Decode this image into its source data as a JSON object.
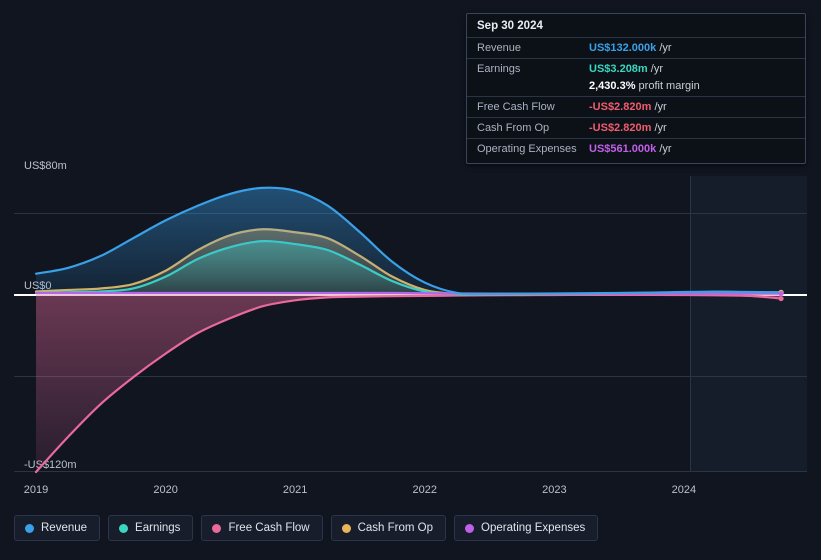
{
  "chart_data": {
    "type": "area",
    "title": "",
    "xlabel": "",
    "ylabel": "",
    "grid": true,
    "legend_position": "bottom-left",
    "ylim": [
      -120,
      80
    ],
    "y_unit": "US$ millions",
    "y_ticks": [
      {
        "value": 80,
        "label": "US$80m"
      },
      {
        "value": 0,
        "label": "US$0"
      },
      {
        "value": -120,
        "label": "-US$120m"
      }
    ],
    "x_ticks": [
      "2019",
      "2020",
      "2021",
      "2022",
      "2023",
      "2024"
    ],
    "x_range": [
      "2018-10",
      "2024-12"
    ],
    "forecast_band_start": "2024-02",
    "x": [
      "2019.0",
      "2019.25",
      "2019.5",
      "2019.75",
      "2020.0",
      "2020.25",
      "2020.5",
      "2020.75",
      "2021.0",
      "2021.25",
      "2021.5",
      "2021.75",
      "2022.0",
      "2022.25",
      "2022.5",
      "2022.75",
      "2023.0",
      "2023.25",
      "2023.5",
      "2023.75",
      "2024.0",
      "2024.25",
      "2024.5",
      "2024.75"
    ],
    "series": [
      {
        "name": "Revenue",
        "color": "#3aa0e8",
        "values": [
          14,
          18,
          26,
          38,
          50,
          60,
          68,
          72,
          70,
          60,
          42,
          22,
          8,
          1,
          0.4,
          0.5,
          0.6,
          0.8,
          1.0,
          1.2,
          1.6,
          1.8,
          1.6,
          1.4
        ]
      },
      {
        "name": "Earnings",
        "color": "#3ad6c0",
        "values": [
          1,
          1.5,
          2,
          4,
          12,
          24,
          32,
          36,
          34,
          30,
          20,
          9,
          2,
          0.2,
          0.1,
          0.2,
          0.3,
          0.4,
          0.6,
          0.8,
          1.2,
          1.6,
          1.5,
          1.3
        ]
      },
      {
        "name": "Free Cash Flow",
        "color": "#e8699a",
        "values": [
          -120,
          -96,
          -74,
          -56,
          -40,
          -26,
          -16,
          -8,
          -4,
          -2,
          -1.5,
          -1.2,
          -1.0,
          -0.8,
          -0.6,
          -0.5,
          -0.4,
          -0.3,
          -0.3,
          -0.3,
          -0.4,
          -0.6,
          -1.0,
          -2.8
        ]
      },
      {
        "name": "Cash From Op",
        "color": "#e8b35a",
        "values": [
          2,
          3,
          4,
          7,
          16,
          30,
          40,
          44,
          42,
          38,
          26,
          12,
          3,
          0.3,
          0.2,
          0.2,
          0.3,
          0.5,
          0.7,
          0.9,
          1.3,
          1.7,
          1.5,
          1.3
        ]
      },
      {
        "name": "Operating Expenses",
        "color": "#c060e8",
        "values": [
          1,
          1,
          1,
          1,
          1,
          1,
          1,
          1,
          1,
          1,
          1,
          1,
          0.8,
          0.6,
          0.5,
          0.5,
          0.5,
          0.5,
          0.5,
          0.5,
          0.5,
          0.56,
          0.56,
          0.56
        ]
      }
    ]
  },
  "tooltip": {
    "date": "Sep 30 2024",
    "rows": [
      {
        "label": "Revenue",
        "value": "US$132.000k",
        "unit": "/yr",
        "color": "#3aa0e8"
      },
      {
        "label": "Earnings",
        "value": "US$3.208m",
        "unit": "/yr",
        "color": "#3ad6c0"
      },
      {
        "label": "Free Cash Flow",
        "value": "-US$2.820m",
        "unit": "/yr",
        "color": "#f05c6e"
      },
      {
        "label": "Cash From Op",
        "value": "-US$2.820m",
        "unit": "/yr",
        "color": "#f05c6e"
      },
      {
        "label": "Operating Expenses",
        "value": "US$561.000k",
        "unit": "/yr",
        "color": "#c060e8"
      }
    ],
    "profit_margin": {
      "value": "2,430.3%",
      "text": "profit margin"
    }
  },
  "axis": {
    "y_top_label": "US$80m",
    "y_zero_label": "US$0",
    "y_bottom_label": "-US$120m",
    "x_labels": [
      "2019",
      "2020",
      "2021",
      "2022",
      "2023",
      "2024"
    ]
  },
  "legend": {
    "items": [
      {
        "label": "Revenue",
        "color": "#3aa0e8"
      },
      {
        "label": "Earnings",
        "color": "#3ad6c0"
      },
      {
        "label": "Free Cash Flow",
        "color": "#e8699a"
      },
      {
        "label": "Cash From Op",
        "color": "#e8b35a"
      },
      {
        "label": "Operating Expenses",
        "color": "#c060e8"
      }
    ]
  },
  "colors": {
    "background": "#101520",
    "grid": "#2b3447",
    "zero_axis": "#ffffff",
    "forecast_band": "#151d2b"
  }
}
